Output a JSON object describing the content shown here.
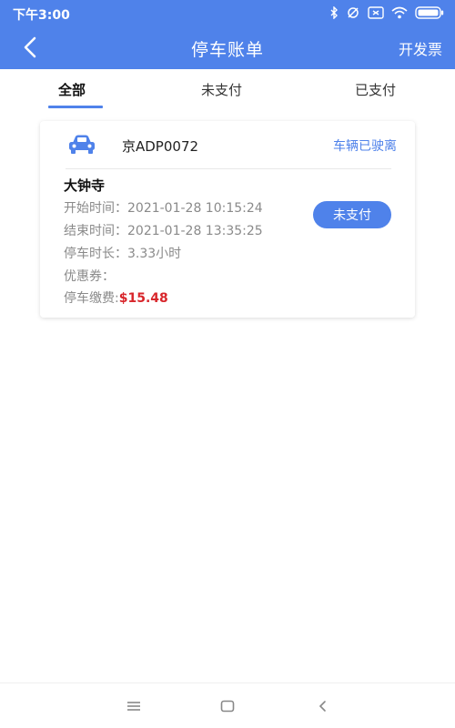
{
  "status_bar": {
    "time": "下午3:00"
  },
  "nav": {
    "title": "停车账单",
    "invoice_label": "开发票"
  },
  "tabs": [
    {
      "label": "全部",
      "active": true
    },
    {
      "label": "未支付",
      "active": false
    },
    {
      "label": "已支付",
      "active": false
    }
  ],
  "bill": {
    "plate": "京ADP0072",
    "vehicle_status": "车辆已驶离",
    "place": "大钟寺",
    "start_label": "开始时间：",
    "start_time": "2021-01-28 10:15:24",
    "end_label": "结束时间：",
    "end_time": "2021-01-28 13:35:25",
    "duration_label": "停车时长：",
    "duration": "3.33小时",
    "coupon_label": "优惠券：",
    "fee_label": "停车缴费:",
    "fee": "$15.48",
    "pay_label": "未支付"
  },
  "colors": {
    "accent": "#4f82ea",
    "fee": "#d8262b"
  }
}
